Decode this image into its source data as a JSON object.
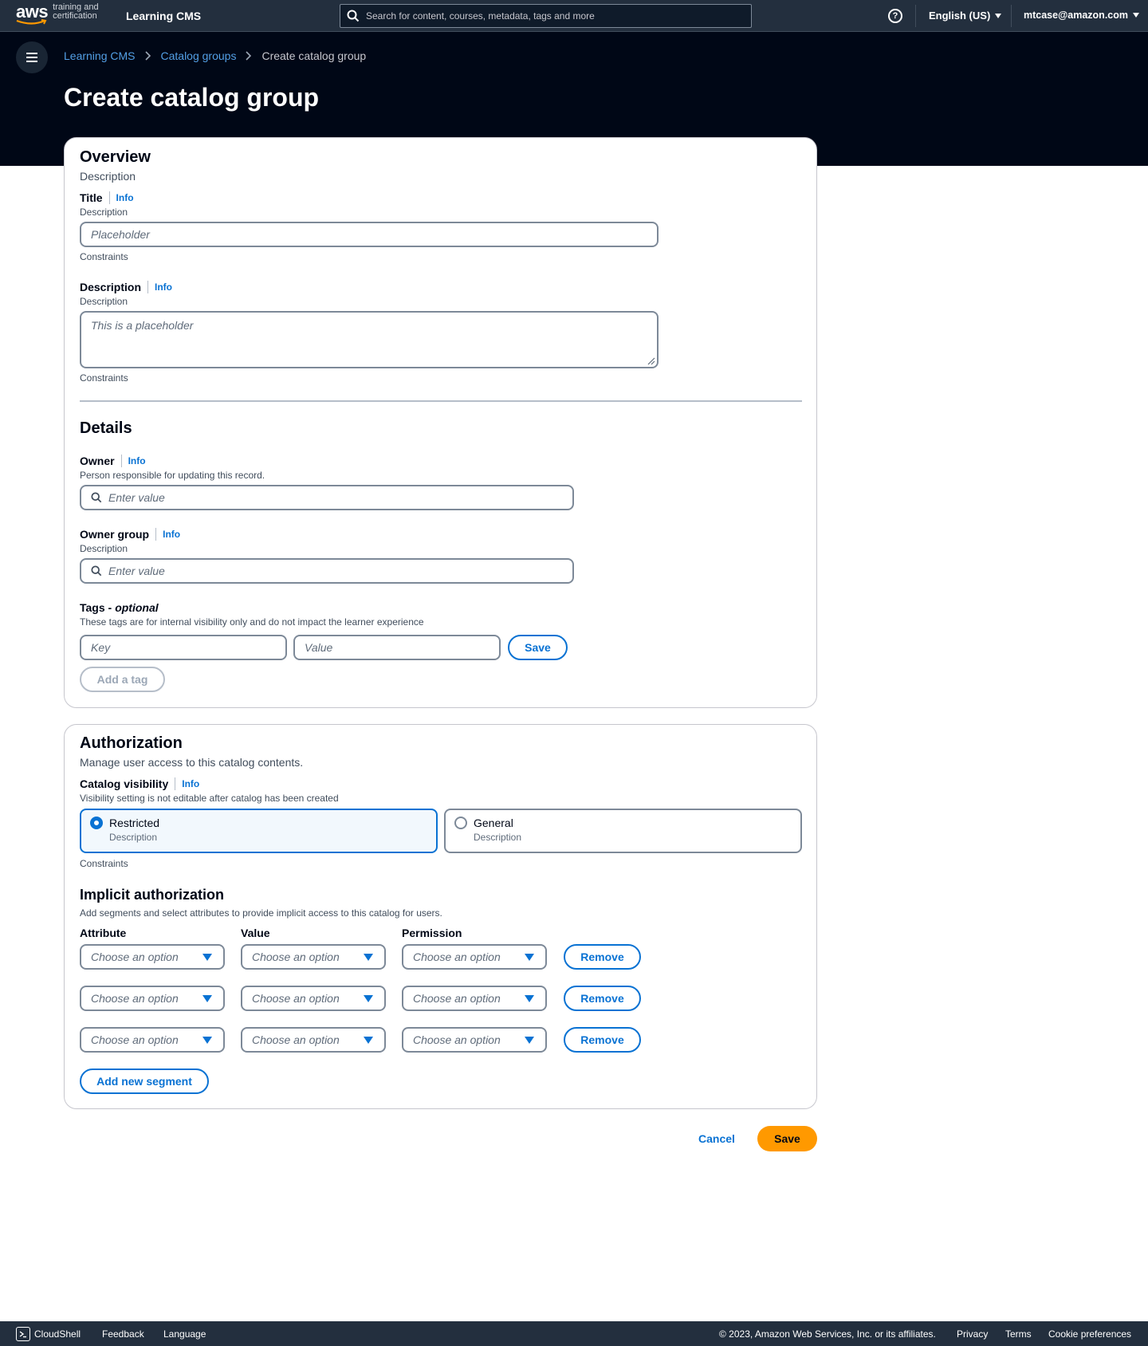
{
  "topnav": {
    "logo_text": "aws",
    "logo_sub_1": "training and",
    "logo_sub_2": "certification",
    "app_name": "Learning CMS",
    "search_placeholder": "Search for content, courses, metadata, tags and more",
    "help_glyph": "?",
    "language": "English (US)",
    "user": "mtcase@amazon.com"
  },
  "breadcrumb": {
    "items": [
      "Learning CMS",
      "Catalog groups"
    ],
    "current": "Create catalog group"
  },
  "page_title": "Create catalog group",
  "overview": {
    "heading": "Overview",
    "description": "Description",
    "title_field": {
      "label": "Title",
      "info": "Info",
      "description": "Description",
      "placeholder": "Placeholder",
      "constraint": "Constraints"
    },
    "description_field": {
      "label": "Description",
      "info": "Info",
      "description": "Description",
      "placeholder": "This is a placeholder",
      "constraint": "Constraints"
    }
  },
  "details": {
    "heading": "Details",
    "owner": {
      "label": "Owner",
      "info": "Info",
      "description": "Person responsible for updating this record.",
      "placeholder": "Enter value"
    },
    "owner_group": {
      "label": "Owner group",
      "info": "Info",
      "description": "Description",
      "placeholder": "Enter value"
    },
    "tags": {
      "label": "Tags - ",
      "label_optional": "optional",
      "description": "These tags are for internal visibility only and do not impact the learner experience",
      "key_placeholder": "Key",
      "value_placeholder": "Value",
      "save_label": "Save",
      "add_tag_label": "Add a tag"
    }
  },
  "authorization": {
    "heading": "Authorization",
    "description": "Manage user access to this catalog contents.",
    "visibility": {
      "label": "Catalog visibility",
      "info": "Info",
      "description": "Visibility setting is not editable after catalog has been created",
      "options": [
        {
          "label": "Restricted",
          "description": "Description",
          "selected": true
        },
        {
          "label": "General",
          "description": "Description",
          "selected": false
        }
      ],
      "constraint": "Constraints"
    },
    "implicit": {
      "heading": "Implicit authorization",
      "description": "Add segments and select attributes to provide implicit access to this catalog for users.",
      "columns": [
        "Attribute",
        "Value",
        "Permission"
      ],
      "select_placeholder": "Choose an option",
      "remove_label": "Remove",
      "rows": 3,
      "add_segment_label": "Add new segment"
    }
  },
  "actions": {
    "cancel_label": "Cancel",
    "save_label": "Save"
  },
  "footer": {
    "cloudshell": "CloudShell",
    "feedback": "Feedback",
    "language": "Language",
    "copyright": "© 2023, Amazon Web Services, Inc. or its affiliates.",
    "privacy": "Privacy",
    "terms": "Terms",
    "cookie": "Cookie preferences"
  },
  "colors": {
    "nav_bg": "#232f3e",
    "hero_bg": "#000716",
    "link": "#0972d3",
    "primary_button": "#ff9900"
  },
  "icons": [
    "search-icon",
    "help-icon",
    "menu-icon",
    "chevron-right-icon",
    "caret-down-icon",
    "cloudshell-icon",
    "resize-handle-icon"
  ]
}
